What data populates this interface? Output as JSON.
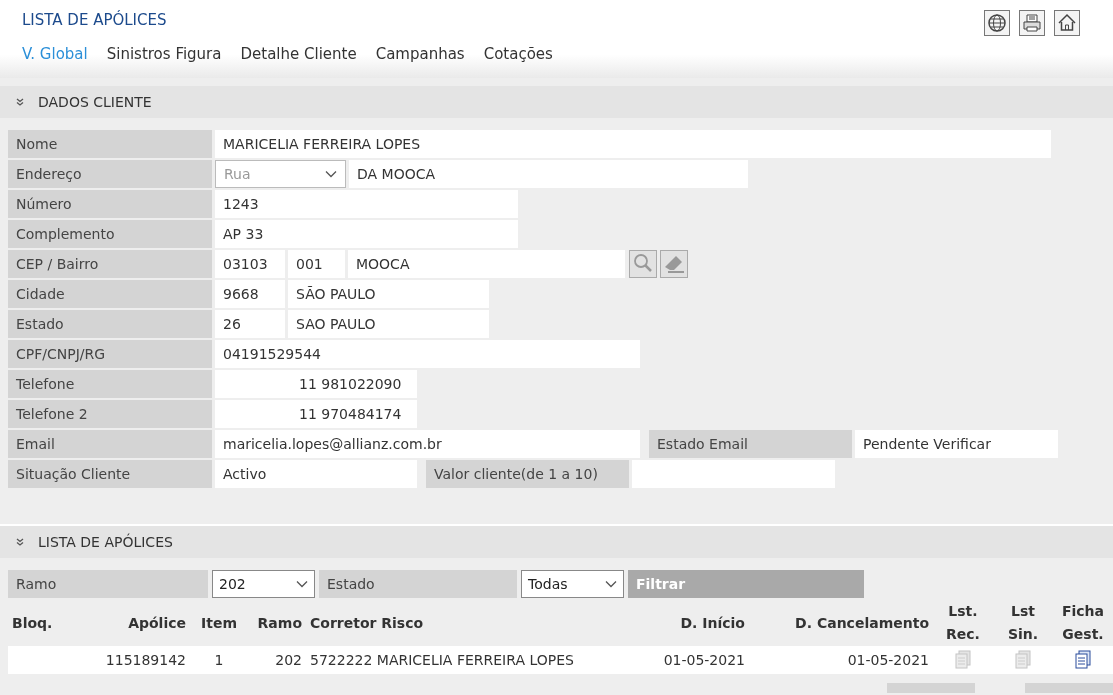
{
  "header": {
    "title": "LISTA DE APÓLICES",
    "tabs": [
      {
        "label": "V. Global",
        "selected": true
      },
      {
        "label": "Sinistros Figura",
        "selected": false
      },
      {
        "label": "Detalhe Cliente",
        "selected": false
      },
      {
        "label": "Campanhas",
        "selected": false
      },
      {
        "label": "Cotações",
        "selected": false
      }
    ]
  },
  "client_section": {
    "title": "DADOS CLIENTE",
    "rows": [
      {
        "label": "Nome",
        "cells": [
          {
            "kind": "text",
            "value": "MARICELIA FERREIRA LOPES"
          }
        ]
      },
      {
        "label": "Endereço",
        "cells": [
          {
            "kind": "select",
            "value": "Rua"
          },
          {
            "kind": "text",
            "value": "DA MOOCA"
          }
        ]
      },
      {
        "label": "Número",
        "cells": [
          {
            "kind": "text",
            "value": "1243"
          }
        ]
      },
      {
        "label": "Complemento",
        "cells": [
          {
            "kind": "text",
            "value": "AP 33"
          }
        ]
      },
      {
        "label": "CEP / Bairro",
        "cells": [
          {
            "kind": "text",
            "value": "03103"
          },
          {
            "kind": "text",
            "value": "001"
          },
          {
            "kind": "text",
            "value": "MOOCA"
          },
          {
            "kind": "search"
          },
          {
            "kind": "eraser"
          }
        ]
      },
      {
        "label": "Cidade",
        "cells": [
          {
            "kind": "text",
            "value": "9668"
          },
          {
            "kind": "text",
            "value": "SÃO PAULO"
          }
        ]
      },
      {
        "label": "Estado",
        "cells": [
          {
            "kind": "text",
            "value": "26"
          },
          {
            "kind": "text",
            "value": "SAO PAULO"
          }
        ]
      },
      {
        "label": "CPF/CNPJ/RG",
        "cells": [
          {
            "kind": "text",
            "value": "04191529544"
          }
        ]
      },
      {
        "label": "Telefone",
        "cells": [
          {
            "kind": "phone",
            "value": "11 981022090"
          }
        ]
      },
      {
        "label": "Telefone 2",
        "cells": [
          {
            "kind": "phone",
            "value": "11 970484174"
          }
        ]
      },
      {
        "label": "Email",
        "cells": [
          {
            "kind": "text",
            "value": "maricelia.lopes@allianz.com.br"
          },
          {
            "kind": "label",
            "value": "Estado Email"
          },
          {
            "kind": "text",
            "value": "Pendente Verificar"
          }
        ]
      },
      {
        "label": "Situação Cliente",
        "cells": [
          {
            "kind": "text",
            "value": "Activo"
          },
          {
            "kind": "label",
            "value": "Valor cliente(de 1 a 10)"
          },
          {
            "kind": "text"
          }
        ]
      }
    ]
  },
  "policies_section": {
    "title": "LISTA DE APÓLICES",
    "filters": [
      {
        "label": "Ramo",
        "value": "202"
      },
      {
        "label": "Estado",
        "value": "Todas"
      }
    ],
    "filter_button": {
      "label": "Filtrar",
      "disabled": true
    },
    "table": {
      "columns": [
        "Bloq.",
        "Apólice",
        "Item",
        "Ramo",
        "Corretor Risco",
        "D. Início",
        "D. Cancelamento",
        "Lst.\nRec.",
        "Lst\nSin.",
        "Ficha\nGest."
      ],
      "rows": [
        {
          "cells": [
            null,
            "115189142",
            "1",
            "202",
            "5722222 MARICELIA FERREIRA LOPES",
            "01-05-2021",
            "01-05-2021"
          ],
          "actions": [
            {
              "disabled": true
            },
            {
              "disabled": true
            },
            {
              "disabled": false
            }
          ]
        }
      ]
    }
  }
}
